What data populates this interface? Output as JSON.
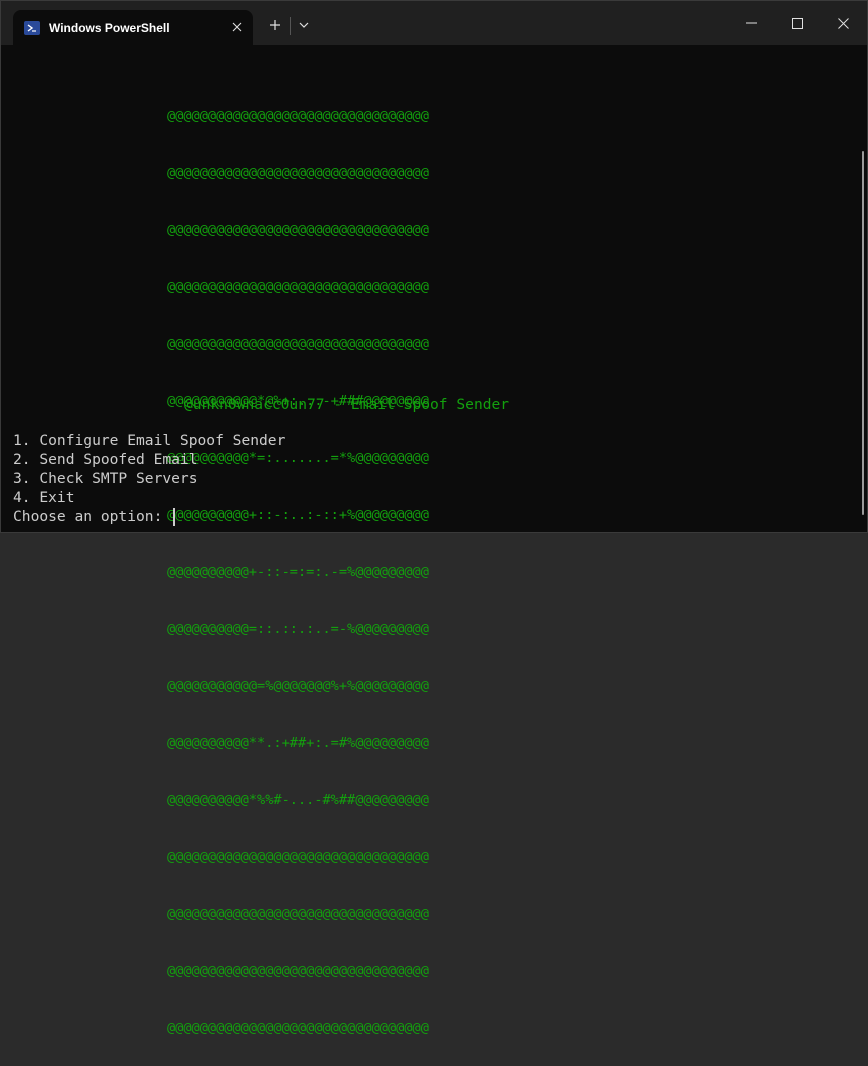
{
  "window": {
    "tab_title": "Windows PowerShell",
    "new_tab": "+",
    "dropdown": "⌄"
  },
  "terminal": {
    "art_lines": [
      "@@@@@@@@@@@@@@@@@@@@@@@@@@@@@@@@",
      "@@@@@@@@@@@@@@@@@@@@@@@@@@@@@@@@",
      "@@@@@@@@@@@@@@@@@@@@@@@@@@@@@@@@",
      "@@@@@@@@@@@@@@@@@@@@@@@@@@@@@@@@",
      "@@@@@@@@@@@@@@@@@@@@@@@@@@@@@@@@",
      "@@@@@@@@@@@*@%+:...-+###@@@@@@@@",
      "@@@@@@@@@@*=:.......=*%@@@@@@@@@",
      "@@@@@@@@@@+::-:..:-::+%@@@@@@@@@",
      "@@@@@@@@@@+-::-=:=:.-=%@@@@@@@@@",
      "@@@@@@@@@@=::.::.:..=-%@@@@@@@@@",
      "@@@@@@@@@@@=%@@@@@@@%+%@@@@@@@@@",
      "@@@@@@@@@@**.:+##+:.=#%@@@@@@@@@",
      "@@@@@@@@@@*%%#-...-#%##@@@@@@@@@",
      "@@@@@@@@@@@@@@@@@@@@@@@@@@@@@@@@",
      "@@@@@@@@@@@@@@@@@@@@@@@@@@@@@@@@",
      "@@@@@@@@@@@@@@@@@@@@@@@@@@@@@@@@",
      "@@@@@@@@@@@@@@@@@@@@@@@@@@@@@@@@"
    ],
    "credit": "@unkn0wnacc0un77 - Email Spoof Sender",
    "menu": [
      "1. Configure Email Spoof Sender",
      "2. Send Spoofed Email",
      "3. Check SMTP Servers",
      "4. Exit"
    ],
    "prompt": "Choose an option: "
  },
  "colors": {
    "terminal_bg": "#0c0c0c",
    "art_green": "#13a10e",
    "text": "#cccccc",
    "titlebar": "#202020"
  }
}
